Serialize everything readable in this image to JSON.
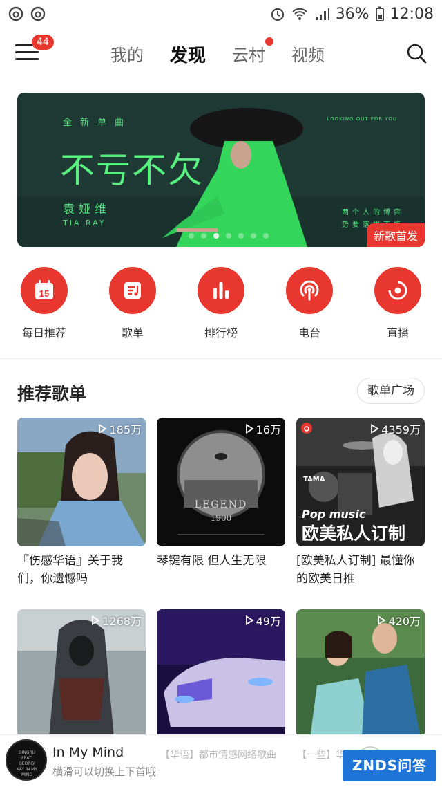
{
  "status_bar": {
    "battery": "36%",
    "time": "12:08",
    "icons": [
      "netease-icon",
      "netease-icon",
      "alarm-icon",
      "wifi-icon",
      "signal-icon",
      "battery-icon"
    ]
  },
  "nav": {
    "menu_badge": "44",
    "tabs": [
      {
        "label": "我的",
        "active": false
      },
      {
        "label": "发现",
        "active": true
      },
      {
        "label": "云村",
        "active": false,
        "dot": true
      },
      {
        "label": "视频",
        "active": false
      }
    ]
  },
  "banner": {
    "tagline": "全新单曲",
    "title": "不亏不欠",
    "artist": "袁娅维",
    "artist_en": "TIA RAY",
    "looking": "LOOKING OUT FOR YOU",
    "side_line1": "两个人的博弈",
    "side_line2": "势要落棋不悔",
    "tag": "新歌首发"
  },
  "shortcuts": [
    {
      "label": "每日推荐",
      "icon": "calendar-icon",
      "day": "15"
    },
    {
      "label": "歌单",
      "icon": "playlist-icon"
    },
    {
      "label": "排行榜",
      "icon": "chart-icon"
    },
    {
      "label": "电台",
      "icon": "radio-icon"
    },
    {
      "label": "直播",
      "icon": "live-icon"
    }
  ],
  "section": {
    "title": "推荐歌单",
    "more_button": "歌单广场"
  },
  "playlists": [
    {
      "plays": "185万",
      "title": "『伤感华语』关于我们，你遗憾吗"
    },
    {
      "plays": "16万",
      "title": "琴键有限 但人生无限",
      "cover_text": "LEGEND",
      "cover_sub": "1900"
    },
    {
      "plays": "4359万",
      "title": "[欧美私人订制] 最懂你的欧美日推",
      "cover_en": "Pop music",
      "cover_cn": "欧美私人订制",
      "cover_brand": "TAMA"
    },
    {
      "plays": "1268万",
      "title": ""
    },
    {
      "plays": "49万",
      "title": ""
    },
    {
      "plays": "420万",
      "title": ""
    }
  ],
  "player": {
    "song": "In My Mind",
    "hint": "横滑可以切换上下首哦",
    "under_text_1": "【华语】都市情感网络歌曲",
    "under_text_2": "【一些】华语",
    "disc_text": "DINGRU FEAT. GEORGI KAY IN MY MIND"
  },
  "watermark": "ZNDS问答",
  "colors": {
    "accent": "#e8372f",
    "banner_bg": "#1f3a35",
    "banner_text": "#58f07e"
  }
}
